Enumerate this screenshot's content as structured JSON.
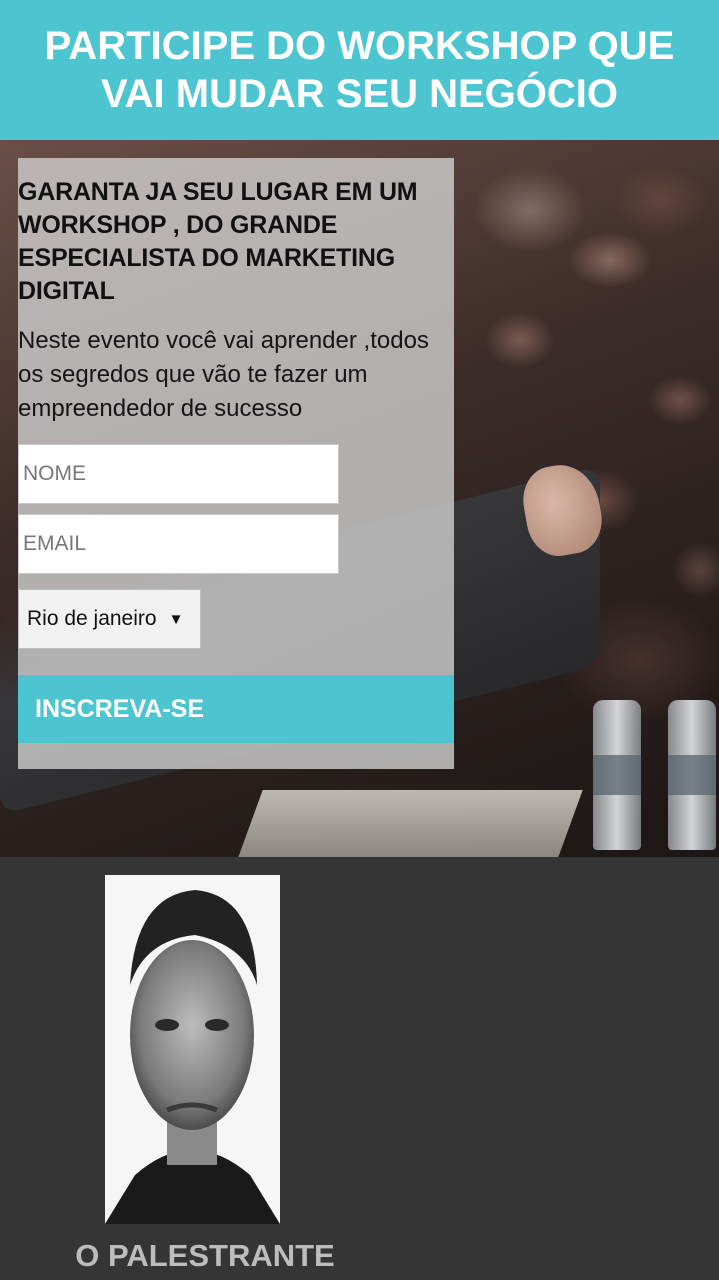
{
  "header": {
    "title": "PARTICIPE DO WORKSHOP QUE VAI MUDAR SEU NEGÓCIO"
  },
  "form": {
    "heading": "GARANTA JA SEU LUGAR EM UM WORKSHOP , DO GRANDE ESPECIALISTA DO MARKETING DIGITAL",
    "description": "Neste evento você vai aprender ,todos os segredos que vão te fazer um empreendedor de sucesso",
    "name_placeholder": "NOME",
    "email_placeholder": "EMAIL",
    "city_select": {
      "selected": "Rio de janeiro"
    },
    "submit_label": "INSCREVA-SE"
  },
  "speaker": {
    "section_title": "O PALESTRANTE"
  },
  "colors": {
    "accent": "#4cc5d0",
    "dark_background": "#353535"
  }
}
